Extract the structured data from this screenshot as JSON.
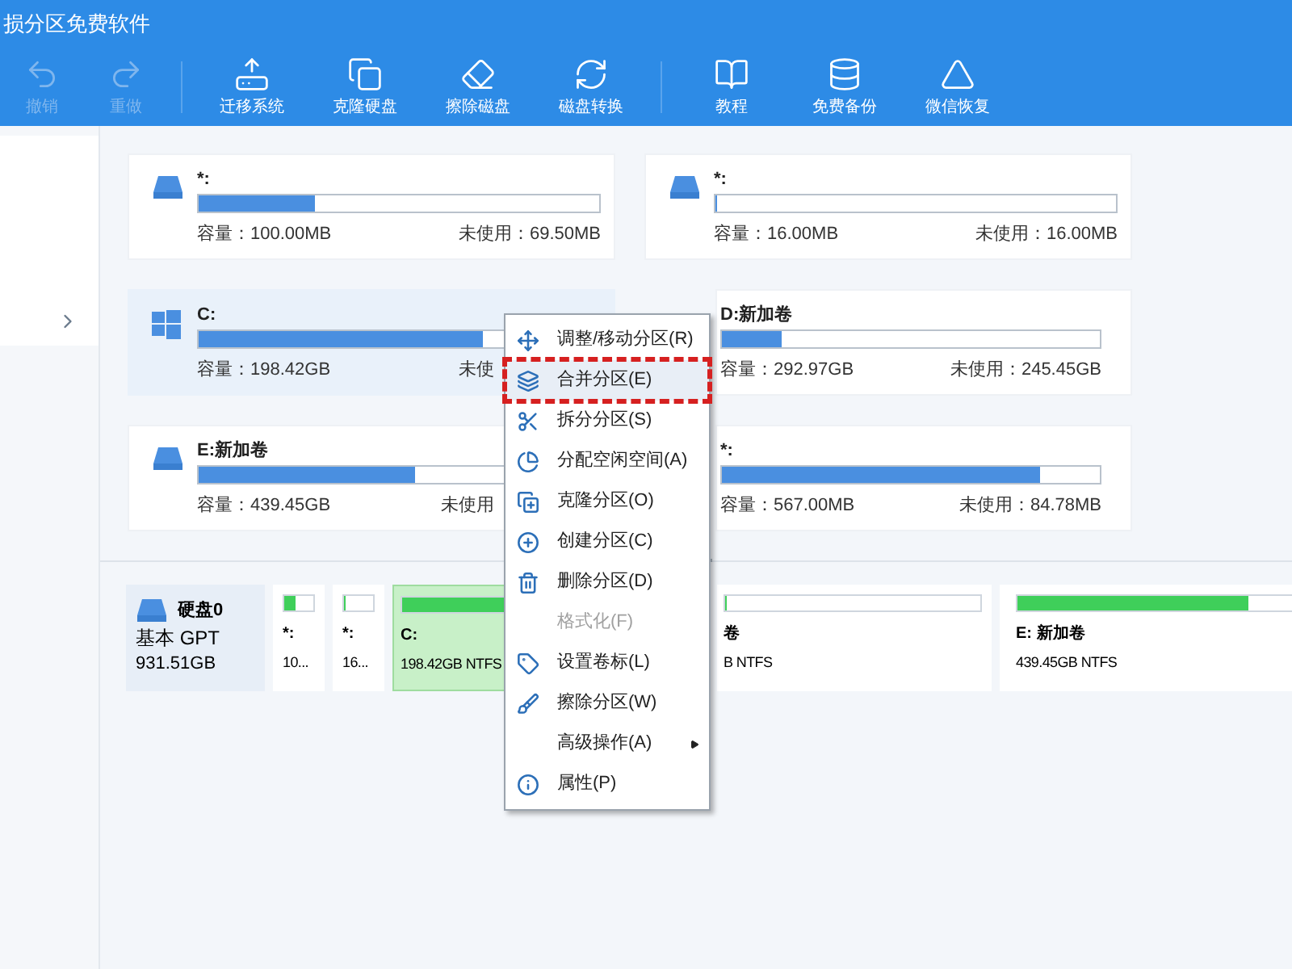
{
  "window": {
    "title": "损分区免费软件"
  },
  "toolbar": [
    {
      "label": "撤销",
      "disabled": true
    },
    {
      "label": "重做",
      "disabled": true
    },
    {
      "label": "迁移系统",
      "disabled": false
    },
    {
      "label": "克隆硬盘",
      "disabled": false
    },
    {
      "label": "擦除磁盘",
      "disabled": false
    },
    {
      "label": "磁盘转换",
      "disabled": false
    },
    {
      "label": "教程",
      "disabled": false
    },
    {
      "label": "免费备份",
      "disabled": false
    },
    {
      "label": "微信恢复",
      "disabled": false
    }
  ],
  "partitions": [
    {
      "kind": "data",
      "label": "*:",
      "level": 0.29,
      "capacity": "容量：100.00MB",
      "unused": "未使用：69.50MB",
      "selected": false
    },
    {
      "kind": "data",
      "label": "*:",
      "level": 0,
      "capacity": "容量：16.00MB",
      "unused": "未使用：16.00MB",
      "selected": false
    },
    {
      "kind": "system",
      "label": "C:",
      "level": 0.71,
      "capacity": "容量：198.42GB",
      "unused": "未使",
      "selected": true
    },
    {
      "kind": "data",
      "label": "D:新加卷",
      "level": 0.16,
      "capacity": "容量：292.97GB",
      "unused": "未使用：245.45GB",
      "selected": false
    },
    {
      "kind": "data",
      "label": "E:新加卷",
      "level": 0.54,
      "capacity": "容量：439.45GB",
      "unused": "未使用",
      "selected": false
    },
    {
      "kind": "data",
      "label": "*:",
      "level": 0.84,
      "capacity": "容量：567.00MB",
      "unused": "未使用：84.78MB",
      "selected": false
    }
  ],
  "disk_map": {
    "name": "硬盘0",
    "type": "基本 GPT",
    "size": "931.51GB",
    "partitions": [
      {
        "label": "*:",
        "info": "10...",
        "level": 0.4,
        "selected": false
      },
      {
        "label": "*:",
        "info": "16...",
        "level": 0,
        "selected": false
      },
      {
        "label": "C:",
        "info": "198.42GB NTFS",
        "level": 1,
        "selected": true
      },
      {
        "label": "卷",
        "info": "B NTFS",
        "level": 0,
        "selected": false
      },
      {
        "label": "E: 新加卷",
        "info": "439.45GB NTFS",
        "level": 0.83,
        "selected": false
      }
    ]
  },
  "context_menu": [
    {
      "label": "调整/移动分区(R)",
      "disabled": false,
      "selected": false,
      "submenu": false
    },
    {
      "label": "合并分区(E)",
      "disabled": false,
      "selected": true,
      "submenu": false
    },
    {
      "label": "拆分分区(S)",
      "disabled": false,
      "selected": false,
      "submenu": false
    },
    {
      "label": "分配空闲空间(A)",
      "disabled": false,
      "selected": false,
      "submenu": false
    },
    {
      "label": "克隆分区(O)",
      "disabled": false,
      "selected": false,
      "submenu": false
    },
    {
      "label": "创建分区(C)",
      "disabled": false,
      "selected": false,
      "submenu": false
    },
    {
      "label": "删除分区(D)",
      "disabled": false,
      "selected": false,
      "submenu": false
    },
    {
      "label": "格式化(F)",
      "disabled": true,
      "selected": false,
      "submenu": false
    },
    {
      "label": "设置卷标(L)",
      "disabled": false,
      "selected": false,
      "submenu": false
    },
    {
      "label": "擦除分区(W)",
      "disabled": false,
      "selected": false,
      "submenu": false
    },
    {
      "label": "高级操作(A)",
      "disabled": false,
      "selected": false,
      "submenu": true
    },
    {
      "label": "属性(P)",
      "disabled": false,
      "selected": false,
      "submenu": false
    }
  ]
}
